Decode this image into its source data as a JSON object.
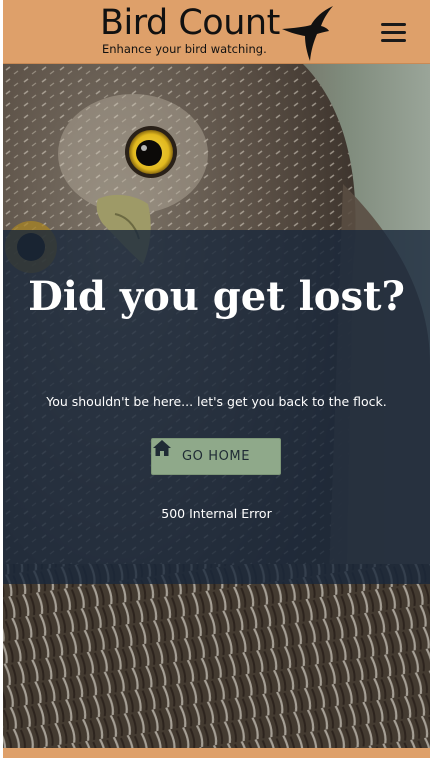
{
  "navbar": {
    "brand_title": "Bird Count",
    "brand_tagline": "Enhance your bird watching.",
    "menu_icon": "hamburger-menu-icon",
    "brand_color": "#dea06a"
  },
  "hero": {
    "image_subject": "owl-photo",
    "overlay_color": "#19283c"
  },
  "error_page": {
    "headline": "Did you get lost?",
    "message": "You shouldn't be here... let's get you back to the flock.",
    "home_button_label": "GO HOME",
    "home_icon": "house-icon",
    "button_color": "#8fa98a",
    "error_code": "500 Internal Error"
  }
}
